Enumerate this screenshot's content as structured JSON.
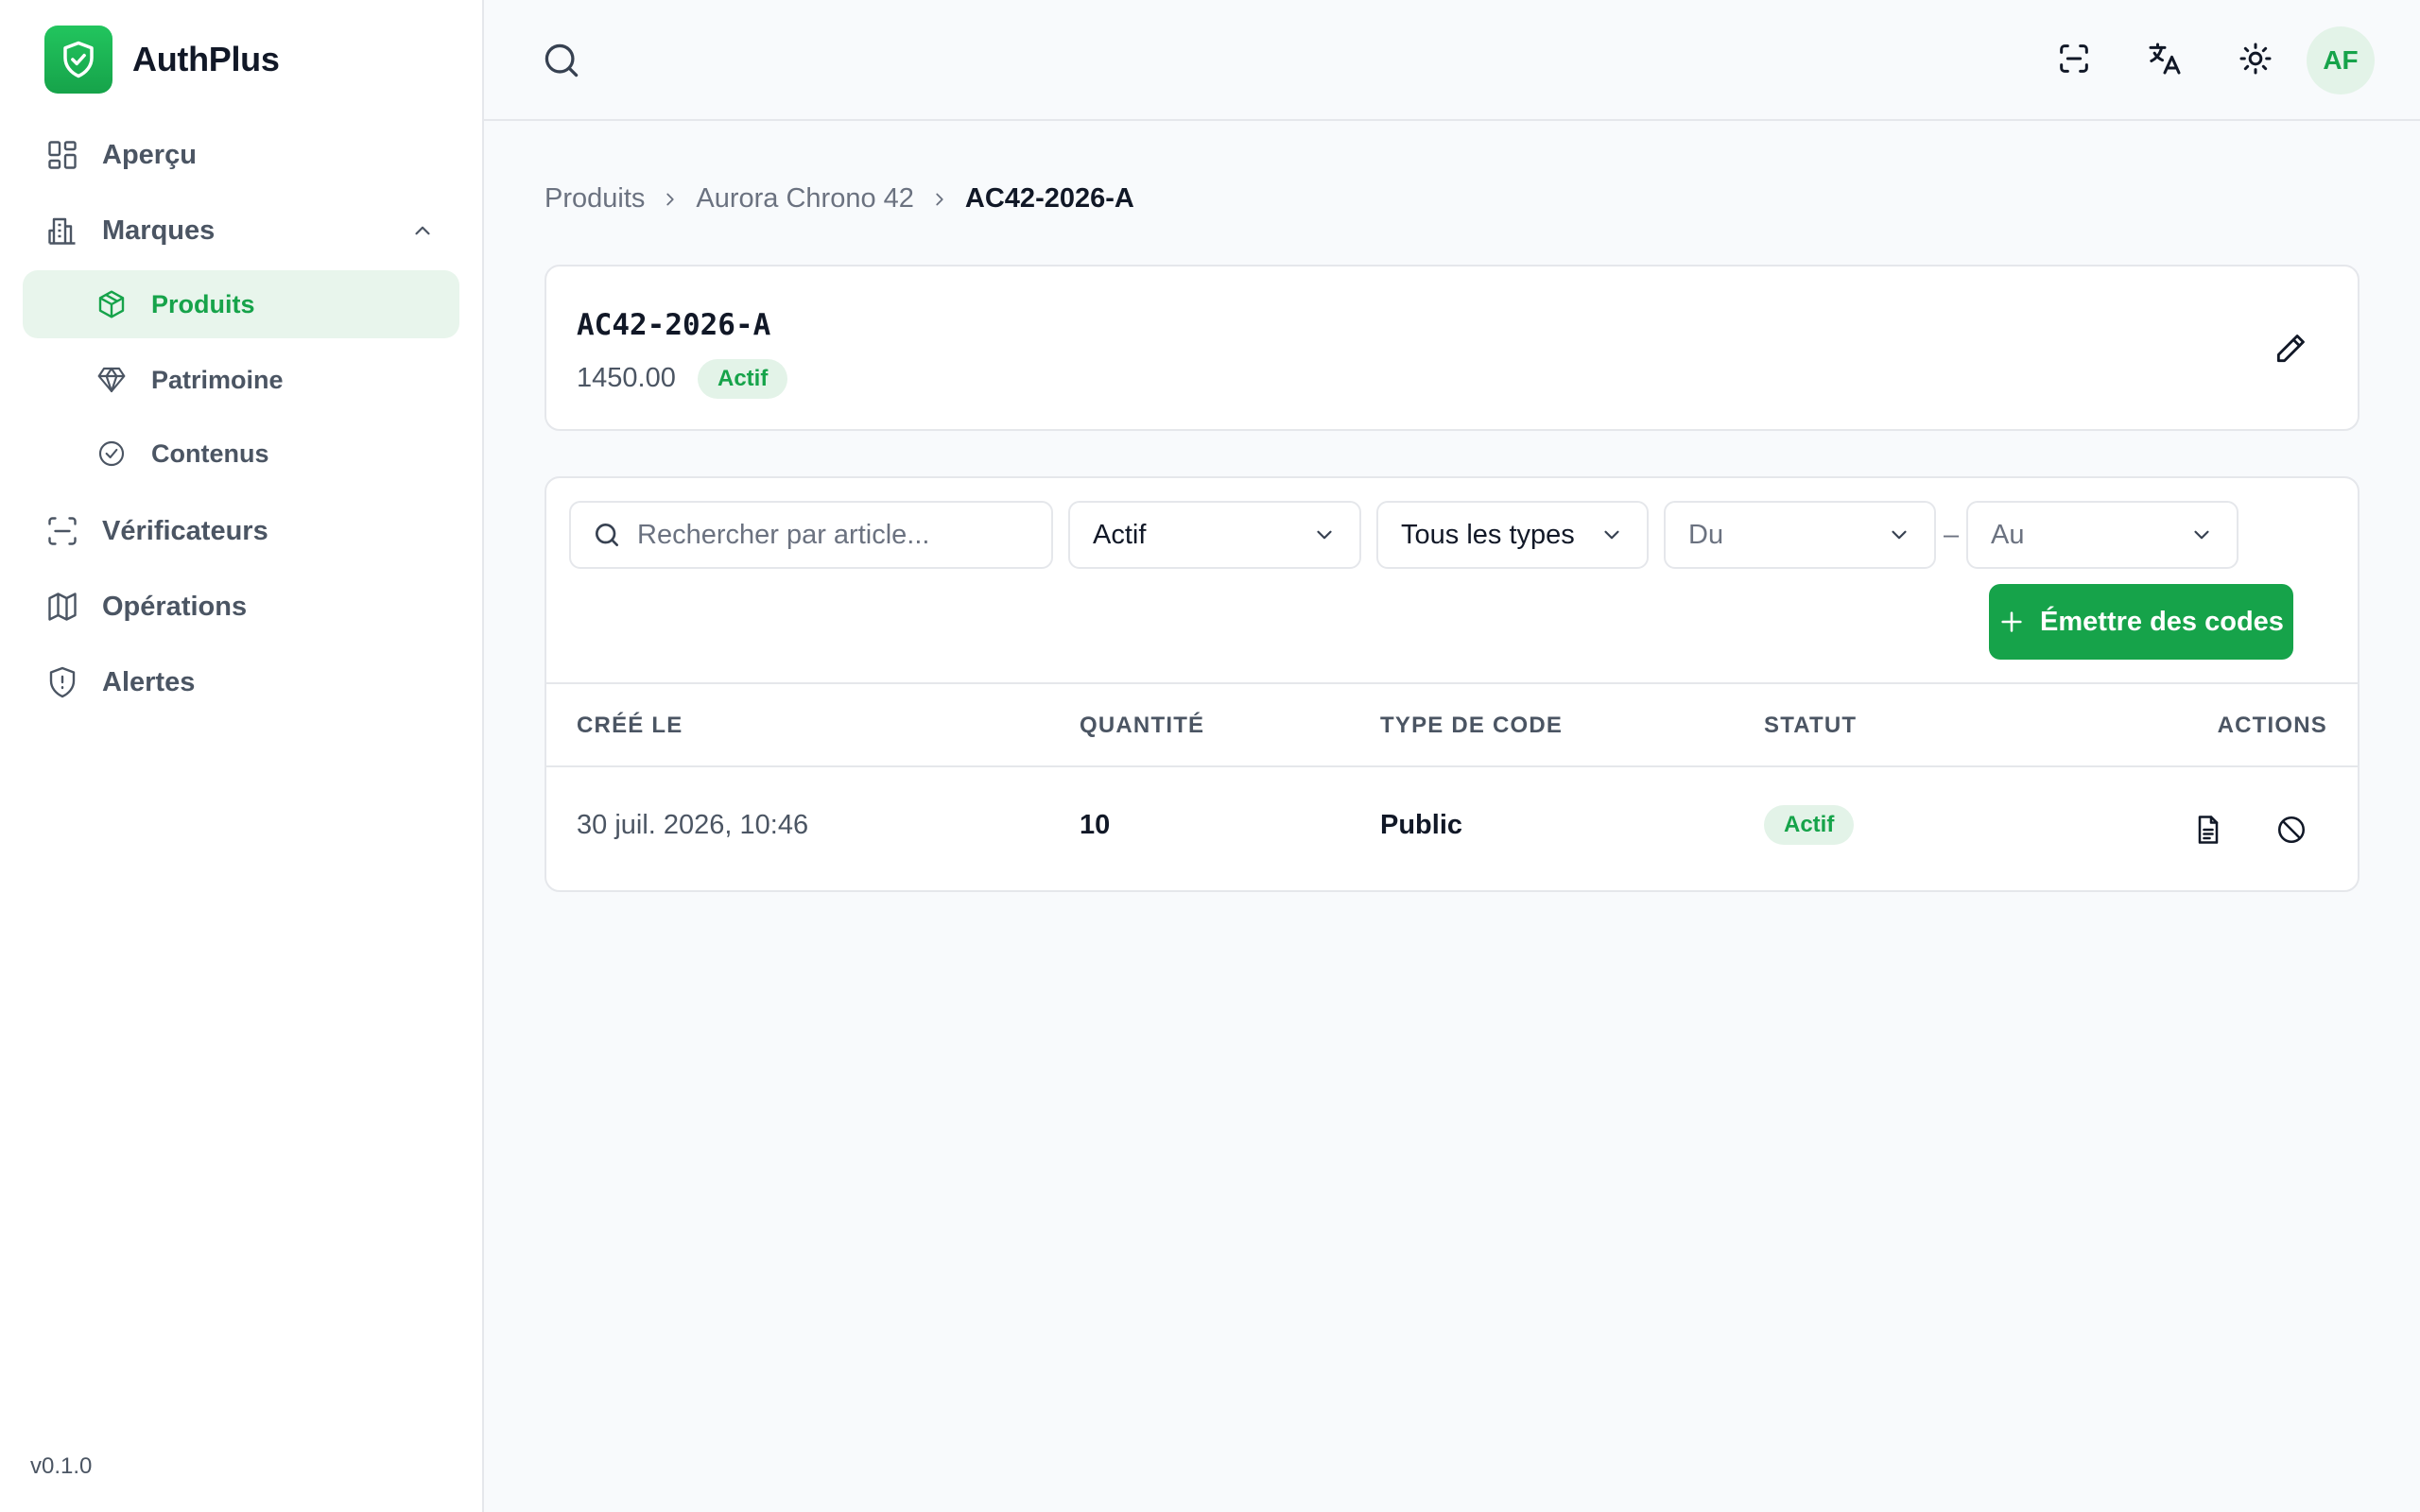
{
  "app": {
    "name": "AuthPlus",
    "version": "v0.1.0"
  },
  "sidebar": {
    "items": [
      {
        "label": "Aperçu",
        "icon": "dashboard-icon"
      },
      {
        "label": "Marques",
        "icon": "building-icon",
        "expanded": true,
        "children": [
          {
            "label": "Produits",
            "icon": "package-icon",
            "active": true
          },
          {
            "label": "Patrimoine",
            "icon": "gem-icon"
          },
          {
            "label": "Contenus",
            "icon": "check-circle-icon"
          }
        ]
      },
      {
        "label": "Vérificateurs",
        "icon": "scan-icon"
      },
      {
        "label": "Opérations",
        "icon": "map-icon"
      },
      {
        "label": "Alertes",
        "icon": "shield-alert-icon"
      }
    ]
  },
  "topbar": {
    "icons": [
      "search-icon",
      "scan-icon",
      "translate-icon",
      "sun-icon"
    ],
    "avatar_initials": "AF"
  },
  "breadcrumb": [
    "Produits",
    "Aurora Chrono 42",
    "AC42-2026-A"
  ],
  "product": {
    "code": "AC42-2026-A",
    "price": "1450.00",
    "status": "Actif"
  },
  "filters": {
    "search_placeholder": "Rechercher par article...",
    "status": "Actif",
    "type": "Tous les types",
    "from": "Du",
    "to": "Au",
    "range_separator": "–"
  },
  "issue_button": "Émettre des codes",
  "table": {
    "headers": [
      "CRÉÉ LE",
      "QUANTITÉ",
      "TYPE DE CODE",
      "STATUT",
      "ACTIONS"
    ],
    "rows": [
      {
        "created": "30 juil. 2026, 10:46",
        "quantity": "10",
        "code_type": "Public",
        "status": "Actif"
      }
    ]
  },
  "colors": {
    "accent": "#16a34a",
    "accent_bg": "#e8f5ec",
    "border": "#e5e7eb"
  }
}
